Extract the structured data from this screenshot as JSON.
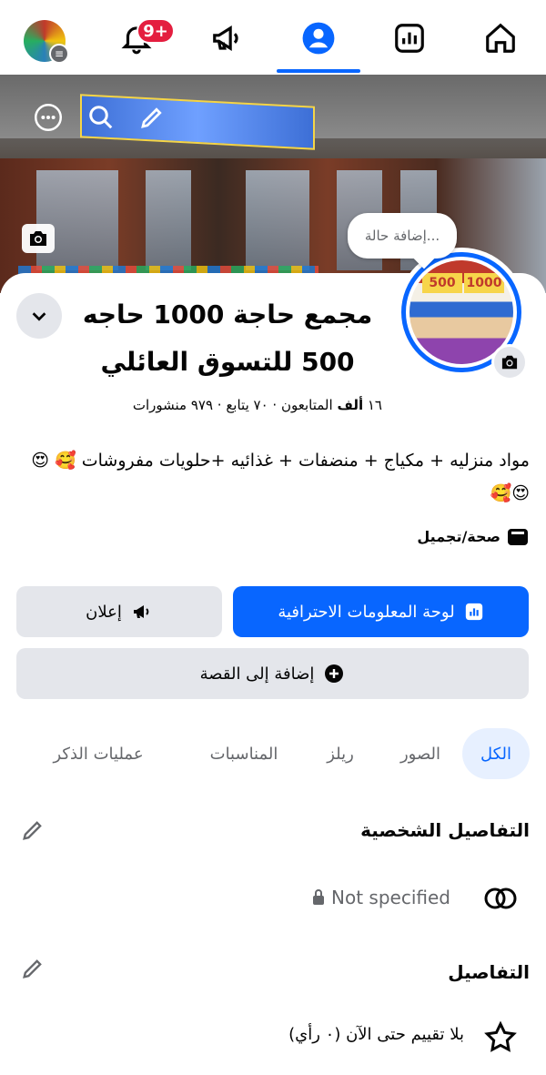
{
  "nav": {
    "notifications_badge": "9+",
    "items": [
      "profile-menu",
      "notifications",
      "ads",
      "profile",
      "dashboard",
      "home"
    ]
  },
  "cover": {
    "status_placeholder": "إضافة حالة..."
  },
  "profile": {
    "name": "مجمع حاجة 1000 حاجه 500 للتسوق العائلي",
    "followers_count": "١٦",
    "followers_unit": "ألف",
    "followers_label": "المتابعون",
    "following": "· ٧٠ يتابع",
    "posts": "· ٩٧٩ منشورات",
    "bio": "مواد منزليه + مكياج + منضفات + غذائيه +حلويات مفروشات 🥰 😍😍🥰",
    "category": "صحة/تجميل"
  },
  "actions": {
    "dashboard_label": "لوحة المعلومات الاحترافية",
    "ad_label": "إعلان",
    "story_label": "إضافة إلى القصة"
  },
  "tabs": [
    {
      "label": "الكل",
      "active": true
    },
    {
      "label": "الصور",
      "active": false
    },
    {
      "label": "ريلز",
      "active": false
    },
    {
      "label": "المناسبات",
      "active": false
    },
    {
      "label": "عمليات الذكر",
      "active": false
    }
  ],
  "personal_details": {
    "title": "التفاصيل الشخصية",
    "relationship_value": "Not specified"
  },
  "details": {
    "title": "التفاصيل",
    "rating_text": "بلا تقييم حتى الآن (٠ رأي)"
  },
  "colors": {
    "accent": "#0866ff",
    "badge": "#e41e3f",
    "button_grey": "#e4e6eb",
    "secondary_text": "#65676b"
  }
}
